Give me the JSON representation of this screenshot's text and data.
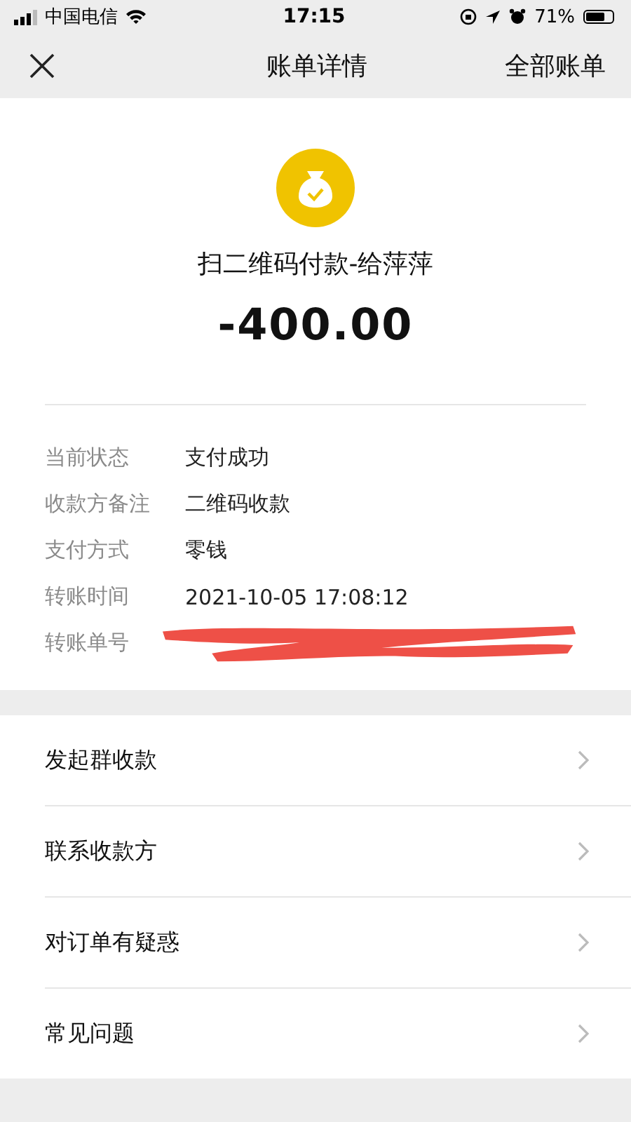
{
  "status_bar": {
    "carrier": "中国电信",
    "time": "17:15",
    "battery_text": "71%"
  },
  "nav": {
    "title": "账单详情",
    "right_action": "全部账单"
  },
  "summary": {
    "title": "扫二维码付款-给萍萍",
    "amount": "-400.00"
  },
  "details": [
    {
      "kind": "text",
      "label": "当前状态",
      "value": "支付成功"
    },
    {
      "kind": "text",
      "label": "收款方备注",
      "value": "二维码收款"
    },
    {
      "kind": "text",
      "label": "支付方式",
      "value": "零钱"
    },
    {
      "kind": "text",
      "label": "转账时间",
      "value": "2021-10-05 17:08:12"
    },
    {
      "kind": "redacted",
      "label": "转账单号"
    }
  ],
  "actions": [
    {
      "label": "发起群收款"
    },
    {
      "label": "联系收款方"
    },
    {
      "label": "对订单有疑惑"
    },
    {
      "label": "常见问题"
    }
  ]
}
